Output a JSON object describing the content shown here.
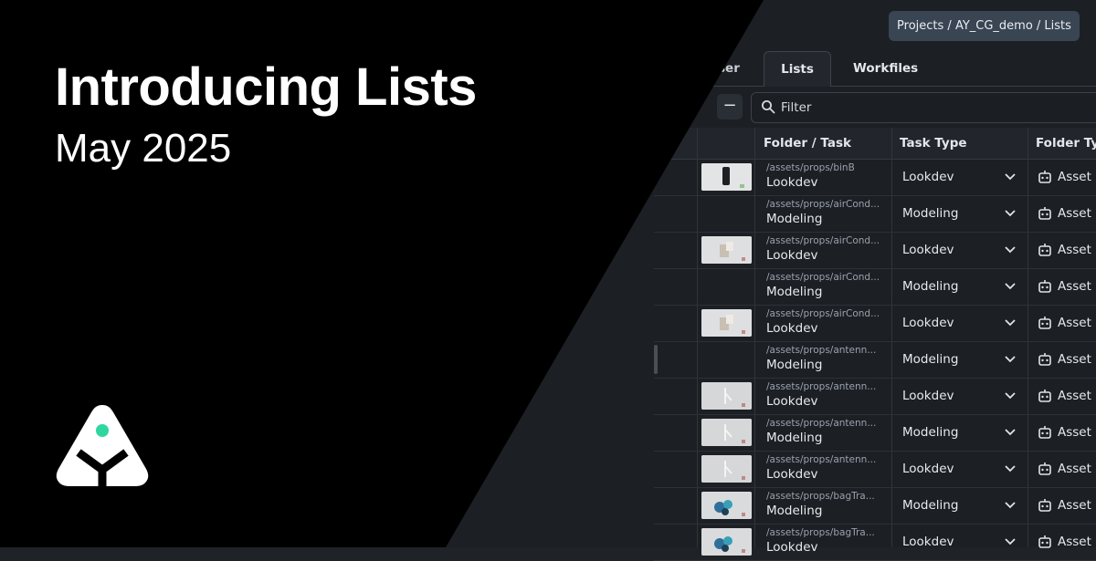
{
  "hero": {
    "title": "Introducing Lists",
    "subtitle": "May 2025",
    "logo_icon": "ayon-logo-icon",
    "accent_color": "#2fd6a0"
  },
  "app": {
    "breadcrumb": "Projects / AY_CG_demo / Lists",
    "tabs": [
      {
        "label": "ser",
        "active": false
      },
      {
        "label": "Lists",
        "active": true
      },
      {
        "label": "Workfiles",
        "active": false
      }
    ],
    "filter": {
      "icon": "search-icon",
      "placeholder": "Filter"
    },
    "minus_button": {
      "label": "−",
      "icon": "minus-icon"
    },
    "columns": [
      "Folder / Task",
      "Task Type",
      "Folder Typ"
    ],
    "folder_type_icon": "asset-icon",
    "rows": [
      {
        "path": "/assets/props/binB",
        "task": "Lookdev",
        "task_type": "Lookdev",
        "folder_type": "Asset",
        "thumbnail": "bin-thumbnail"
      },
      {
        "path": "/assets/props/airCond...",
        "task": "Modeling",
        "task_type": "Modeling",
        "folder_type": "Asset",
        "thumbnail": ""
      },
      {
        "path": "/assets/props/airCond...",
        "task": "Lookdev",
        "task_type": "Lookdev",
        "folder_type": "Asset",
        "thumbnail": "aircond-thumbnail"
      },
      {
        "path": "/assets/props/airCond...",
        "task": "Modeling",
        "task_type": "Modeling",
        "folder_type": "Asset",
        "thumbnail": ""
      },
      {
        "path": "/assets/props/airCond...",
        "task": "Lookdev",
        "task_type": "Lookdev",
        "folder_type": "Asset",
        "thumbnail": "aircond-thumbnail"
      },
      {
        "path": "/assets/props/antenn...",
        "task": "Modeling",
        "task_type": "Modeling",
        "folder_type": "Asset",
        "thumbnail": ""
      },
      {
        "path": "/assets/props/antenn...",
        "task": "Lookdev",
        "task_type": "Lookdev",
        "folder_type": "Asset",
        "thumbnail": "antenna-thumbnail"
      },
      {
        "path": "/assets/props/antenn...",
        "task": "Modeling",
        "task_type": "Modeling",
        "folder_type": "Asset",
        "thumbnail": "antenna-thumbnail"
      },
      {
        "path": "/assets/props/antenn...",
        "task": "Lookdev",
        "task_type": "Lookdev",
        "folder_type": "Asset",
        "thumbnail": "antenna-thumbnail"
      },
      {
        "path": "/assets/props/bagTra...",
        "task": "Modeling",
        "task_type": "Modeling",
        "folder_type": "Asset",
        "thumbnail": "bag-thumbnail"
      },
      {
        "path": "/assets/props/bagTra...",
        "task": "Lookdev",
        "task_type": "Lookdev",
        "folder_type": "Asset",
        "thumbnail": "bag-thumbnail"
      }
    ]
  }
}
